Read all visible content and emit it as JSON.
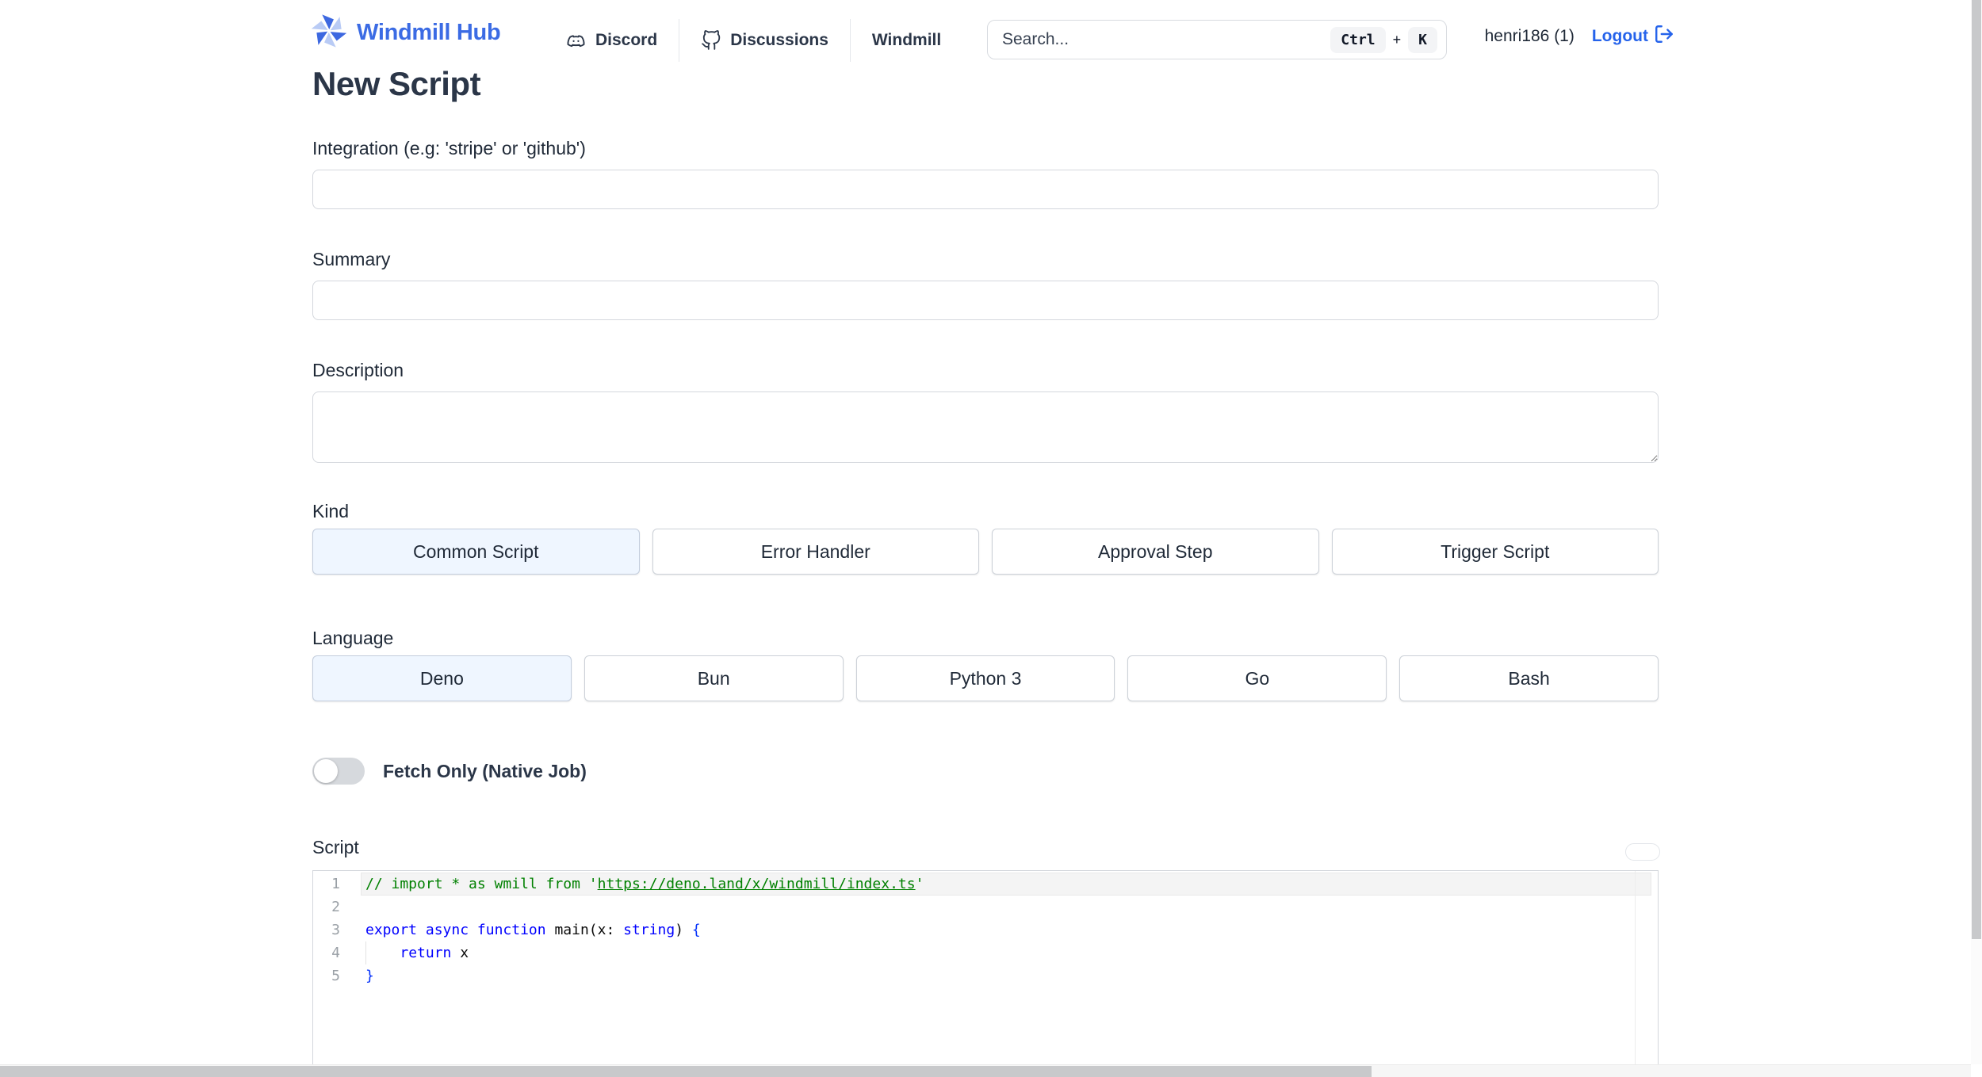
{
  "header": {
    "brand": "Windmill Hub",
    "nav": {
      "discord": "Discord",
      "discussions": "Discussions",
      "windmill": "Windmill"
    },
    "search": {
      "placeholder": "Search...",
      "shortcut_ctrl": "Ctrl",
      "shortcut_plus": "+",
      "shortcut_key": "K"
    },
    "user": "henri186 (1)",
    "logout": "Logout"
  },
  "page": {
    "title": "New Script",
    "integration": {
      "label": "Integration (e.g: 'stripe' or 'github')",
      "value": ""
    },
    "summary": {
      "label": "Summary",
      "value": ""
    },
    "description": {
      "label": "Description",
      "value": ""
    },
    "kind": {
      "label": "Kind",
      "options": [
        "Common Script",
        "Error Handler",
        "Approval Step",
        "Trigger Script"
      ],
      "selected": "Common Script",
      "selected_index": 0
    },
    "language": {
      "label": "Language",
      "options": [
        "Deno",
        "Bun",
        "Python 3",
        "Go",
        "Bash"
      ],
      "selected": "Deno",
      "selected_index": 0
    },
    "fetch_only": {
      "label": "Fetch Only (Native Job)",
      "enabled": false
    },
    "script": {
      "label": "Script",
      "lines": [
        {
          "num": "1",
          "active": true,
          "tokens": [
            {
              "t": "// import * as wmill from '",
              "c": "comment"
            },
            {
              "t": "https://deno.land/x/windmill/index.ts",
              "c": "link"
            },
            {
              "t": "'",
              "c": "comment"
            }
          ]
        },
        {
          "num": "2",
          "tokens": []
        },
        {
          "num": "3",
          "tokens": [
            {
              "t": "export",
              "c": "kw"
            },
            {
              "t": " ",
              "c": "pl"
            },
            {
              "t": "async",
              "c": "kw"
            },
            {
              "t": " ",
              "c": "pl"
            },
            {
              "t": "function",
              "c": "kw"
            },
            {
              "t": " main",
              "c": "pl"
            },
            {
              "t": "(x: ",
              "c": "pl"
            },
            {
              "t": "string",
              "c": "kw"
            },
            {
              "t": ") ",
              "c": "pl"
            },
            {
              "t": "{",
              "c": "br"
            }
          ]
        },
        {
          "num": "4",
          "guide": true,
          "tokens": [
            {
              "t": "    ",
              "c": "pl"
            },
            {
              "t": "return",
              "c": "kw"
            },
            {
              "t": " x",
              "c": "pl"
            }
          ]
        },
        {
          "num": "5",
          "tokens": [
            {
              "t": "}",
              "c": "br"
            }
          ]
        }
      ]
    }
  },
  "colors": {
    "accent": "#3b6be4",
    "logout_blue": "#2563eb",
    "selected_bg": "#eff6ff",
    "comment_green": "#008000",
    "keyword_blue": "#0000ff",
    "bracket_blue": "#0431fa"
  }
}
